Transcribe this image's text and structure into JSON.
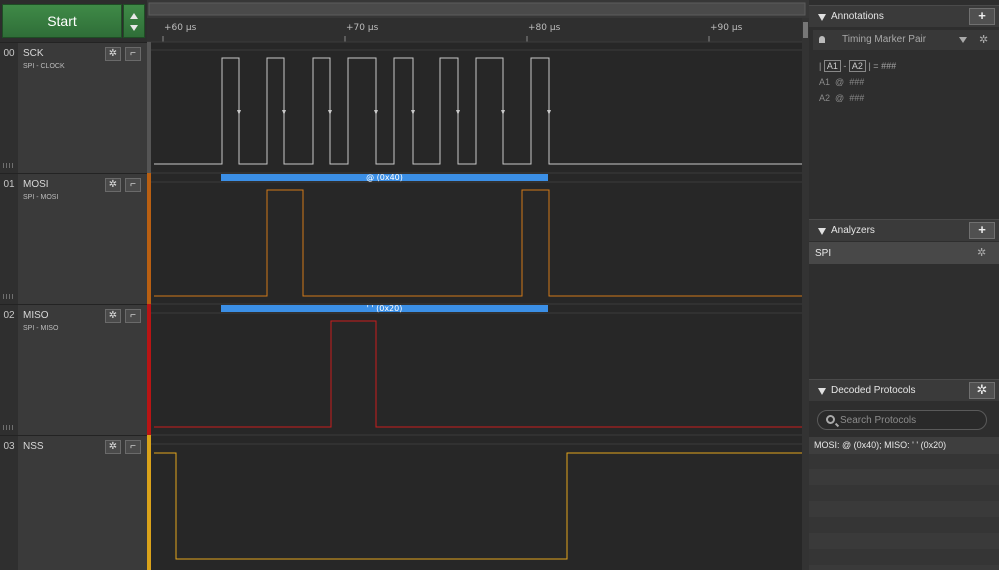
{
  "toolbar": {
    "start_label": "Start"
  },
  "channels": [
    {
      "index": "00",
      "name": "SCK",
      "subtitle": "SPI - CLOCK",
      "color": "#c8c8c8"
    },
    {
      "index": "01",
      "name": "MOSI",
      "subtitle": "SPI - MOSI",
      "color": "#d07a1a"
    },
    {
      "index": "02",
      "name": "MISO",
      "subtitle": "SPI - MISO",
      "color": "#c81e1e"
    },
    {
      "index": "03",
      "name": "NSS",
      "subtitle": "",
      "color": "#e3a41c"
    }
  ],
  "timeline": {
    "ticks": [
      "+60 μs",
      "+70 μs",
      "+80 μs",
      "+90 μs"
    ]
  },
  "decodes": {
    "mosi_label": "@ (0x40)",
    "miso_label": "' ' (0x20)",
    "bar_color": "#3b8fe6"
  },
  "annotations": {
    "title": "Annotations",
    "add_label": "+",
    "marker_name": "Timing Marker Pair",
    "line1_pipe_open": "|",
    "line1_a1": "A1",
    "line1_dash": "-",
    "line1_a2": "A2",
    "line1_pipe_close": "|",
    "line1_eq": "=",
    "line1_value": "###",
    "a1_label": "A1",
    "a1_at": "@",
    "a1_value": "###",
    "a2_label": "A2",
    "a2_at": "@",
    "a2_value": "###"
  },
  "analyzers": {
    "title": "Analyzers",
    "add_label": "+",
    "items": [
      "SPI"
    ]
  },
  "decoded_protocols": {
    "title": "Decoded Protocols",
    "search_placeholder": "Search Protocols",
    "rows": [
      "MOSI: @ (0x40);  MISO: ' ' (0x20)"
    ]
  }
}
